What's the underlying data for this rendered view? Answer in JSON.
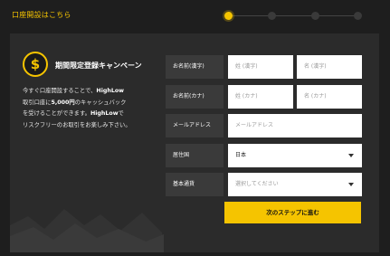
{
  "header": {
    "title": "口座開設はこちら",
    "steps_count": 4,
    "active_step": 1
  },
  "promo": {
    "title": "期間限定登録キャンペーン",
    "text_line1_a": "今すぐ口座開設することで、",
    "text_line1_b": "HighLow",
    "text_line2_a": "取引口座に",
    "text_line2_b": "5,000円",
    "text_line2_c": "のキャッシュバック",
    "text_line3_a": "を受けることができます。",
    "text_line3_b": "HighLow",
    "text_line3_c": "で",
    "text_line4": "リスクフリーのお取引をお楽しみ下さい。",
    "icon": "dollar-coin-icon"
  },
  "form": {
    "name_kanji_label": "お名前(漢字)",
    "last_name_kanji_placeholder": "姓 (漢字)",
    "first_name_kanji_placeholder": "名 (漢字)",
    "name_kana_label": "お名前(カナ)",
    "last_name_kana_placeholder": "姓 (カナ)",
    "first_name_kana_placeholder": "名 (カナ)",
    "email_label": "メールアドレス",
    "email_placeholder": "メールアドレス",
    "country_label": "居住国",
    "country_value": "日本",
    "currency_label": "基本通貨",
    "currency_placeholder": "選択してください",
    "submit_label": "次のステップに進む"
  },
  "colors": {
    "accent": "#f5c400",
    "background": "#1e1e1e",
    "panel": "#2b2b2b",
    "label_bg": "#3a3a3a"
  }
}
